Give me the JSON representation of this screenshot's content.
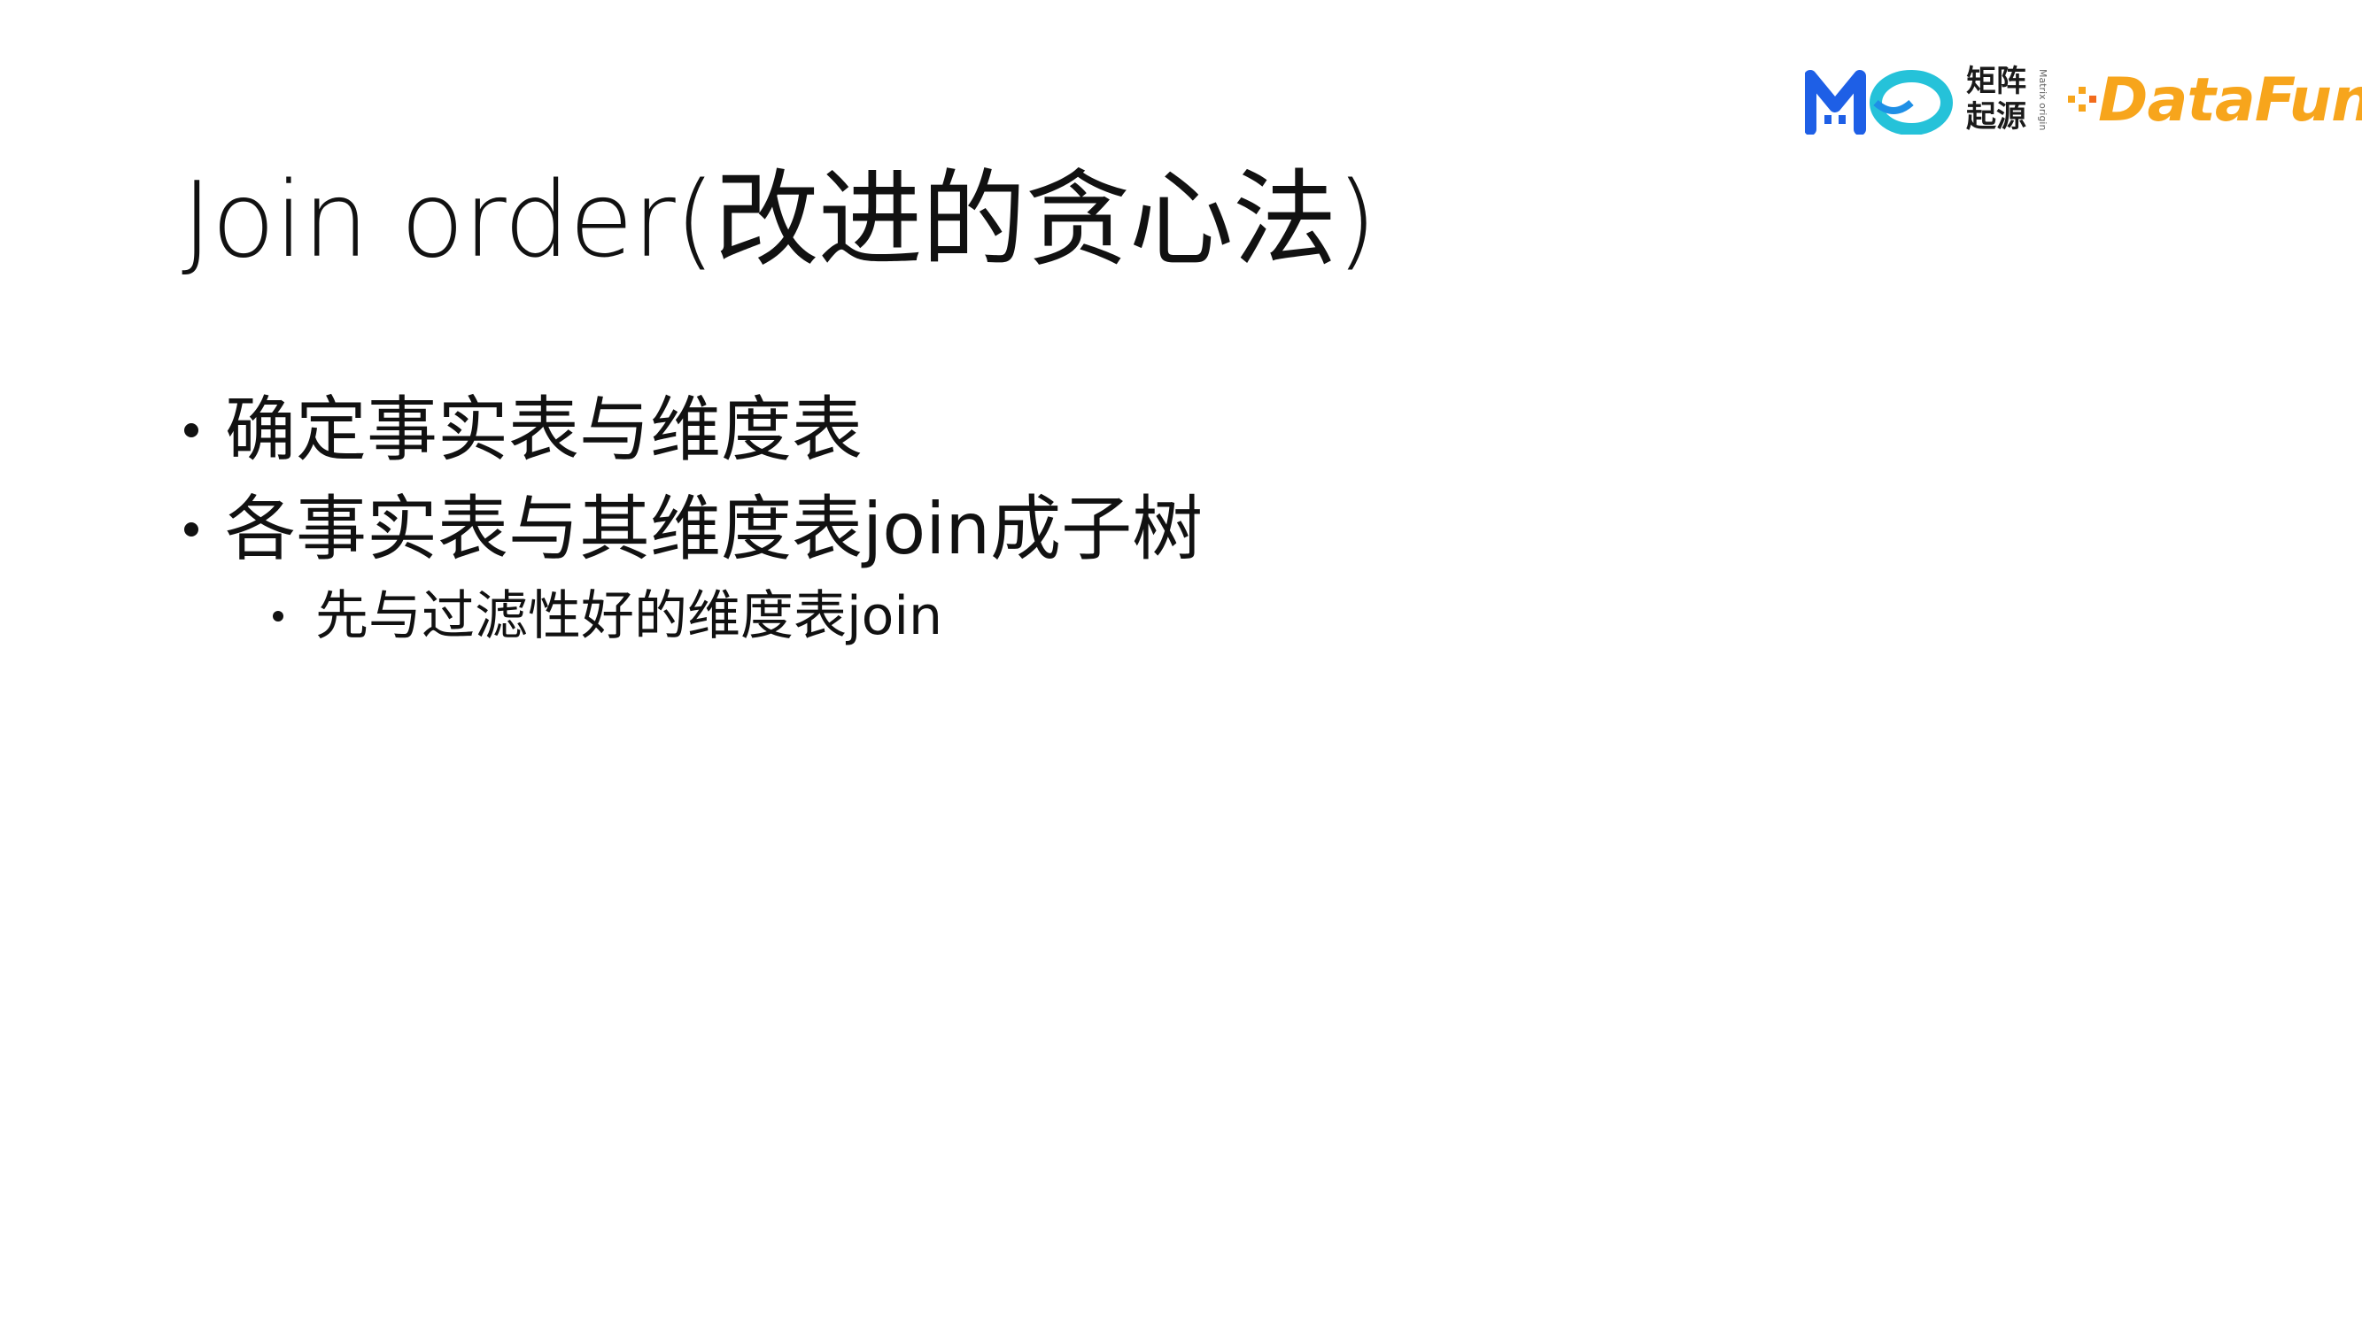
{
  "slide": {
    "title": "Join  order(改进的贪心法)",
    "bullets": [
      {
        "level": 1,
        "text": "确定事实表与维度表"
      },
      {
        "level": 1,
        "text": "各事实表与其维度表join成子树"
      },
      {
        "level": 2,
        "text": "先与过滤性好的维度表join"
      }
    ]
  },
  "logos": {
    "matrix_origin": {
      "mark": "MO",
      "cn_line1": "矩阵",
      "cn_line2": "起源",
      "en": "Matrix origin",
      "colors": {
        "m": "#1e5fe6",
        "o": "#25c2d9"
      }
    },
    "datafun": {
      "text": "DataFun.",
      "colors": {
        "primary": "#f7a51c",
        "accent": "#f26b1d"
      }
    }
  }
}
